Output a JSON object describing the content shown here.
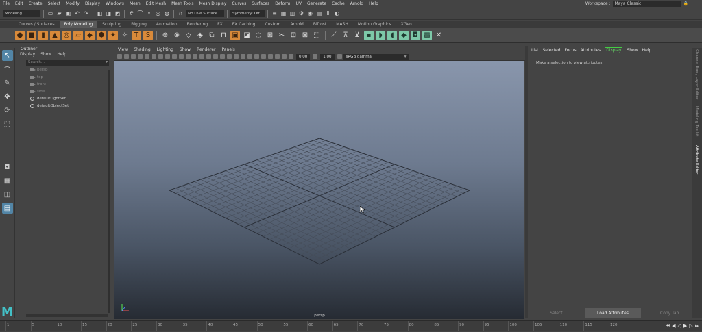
{
  "menubar": {
    "items": [
      "File",
      "Edit",
      "Create",
      "Select",
      "Modify",
      "Display",
      "Windows",
      "Mesh",
      "Edit Mesh",
      "Mesh Tools",
      "Mesh Display",
      "Curves",
      "Surfaces",
      "Deform",
      "UV",
      "Generate",
      "Cache",
      "Arnold",
      "Help"
    ],
    "workspace_label": "Workspace :",
    "workspace_value": "Maya Classic"
  },
  "statusline": {
    "menuset": "Modeling",
    "live_surface": "No Live Surface",
    "symmetry": "Symmetry: Off"
  },
  "shelf_tabs": [
    "Curves / Surfaces",
    "Poly Modeling",
    "Sculpting",
    "Rigging",
    "Animation",
    "Rendering",
    "FX",
    "FX Caching",
    "Custom",
    "Arnold",
    "Bifrost",
    "MASH",
    "Motion Graphics",
    "XGen"
  ],
  "shelf_active": "Poly Modeling",
  "outliner": {
    "title": "Outliner",
    "menu": [
      "Display",
      "Show",
      "Help"
    ],
    "search_placeholder": "Search...",
    "items": [
      {
        "label": "persp",
        "type": "camera"
      },
      {
        "label": "top",
        "type": "camera"
      },
      {
        "label": "front",
        "type": "camera"
      },
      {
        "label": "side",
        "type": "camera"
      },
      {
        "label": "defaultLightSet",
        "type": "set"
      },
      {
        "label": "defaultObjectSet",
        "type": "set"
      }
    ]
  },
  "viewport": {
    "menu": [
      "View",
      "Shading",
      "Lighting",
      "Show",
      "Renderer",
      "Panels"
    ],
    "exposure": "0.00",
    "gamma": "1.00",
    "color_space": "sRGB gamma",
    "camera_label": "persp"
  },
  "attribute_editor": {
    "menu": [
      "List",
      "Selected",
      "Focus",
      "Attributes",
      "Display",
      "Show",
      "Help"
    ],
    "active_menu": "Display",
    "message": "Make a selection to view attributes",
    "buttons": [
      "Select",
      "Load Attributes",
      "Copy Tab"
    ],
    "side_tabs": [
      "Channel Box / Layer Editor",
      "Modeling Toolkit",
      "Attribute Editor"
    ]
  },
  "timeline": {
    "ticks": [
      "1",
      "5",
      "10",
      "15",
      "20",
      "25",
      "30",
      "35",
      "40",
      "45",
      "50",
      "55",
      "60",
      "65",
      "70",
      "75",
      "80",
      "85",
      "90",
      "95",
      "100",
      "105",
      "110",
      "115",
      "120"
    ]
  },
  "colors": {
    "maya_logo": "#43c0c6",
    "shelf_orange": "#d98a3a",
    "shelf_green": "#7dc8a8",
    "active_tool": "#5285a6",
    "display_highlight": "#66dd66"
  }
}
